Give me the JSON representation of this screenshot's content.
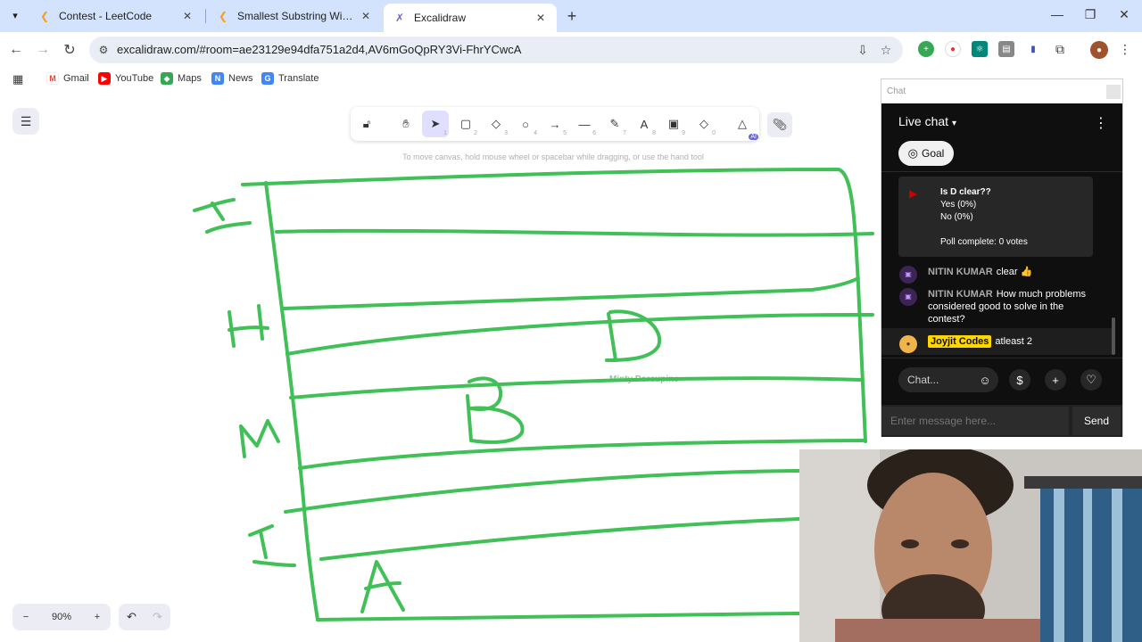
{
  "browser": {
    "tabs": [
      {
        "title": "Contest - LeetCode",
        "favicon": "leetcode-icon"
      },
      {
        "title": "Smallest Substring With Identical",
        "favicon": "leetcode-icon"
      },
      {
        "title": "Excalidraw",
        "favicon": "excalidraw-icon",
        "active": true
      }
    ],
    "url": "excalidraw.com/#room=ae23129e94dfa751a2d4,AV6mGoQpRY3Vi-FhrYCwcA",
    "bookmarks": [
      "Gmail",
      "YouTube",
      "Maps",
      "News",
      "Translate"
    ]
  },
  "excalidraw": {
    "hint": "To move canvas, hold mouse wheel or spacebar while dragging, or use the hand tool",
    "tool_keys": [
      "1",
      "2",
      "3",
      "4",
      "5",
      "6",
      "7",
      "8",
      "9",
      "0"
    ],
    "ai_badge": "AI",
    "zoom": "90%",
    "collaborator": "Minty Porcupine",
    "colors": {
      "stroke": "#40c057",
      "selected_tool": "#e0dfff"
    }
  },
  "chat": {
    "window_label": "Chat",
    "header": "Live chat",
    "goal": "Goal",
    "poll": {
      "question": "Is D clear??",
      "options": [
        "Yes (0%)",
        "No (0%)"
      ],
      "status": "Poll complete: 0 votes"
    },
    "messages": [
      {
        "author": "NITIN KUMAR",
        "text": "clear 👍"
      },
      {
        "author": "NITIN KUMAR",
        "text": "How much problems considered good to solve in the contest?"
      },
      {
        "author": "Joyjit Codes",
        "text": "atleast 2",
        "owner": true
      }
    ],
    "input_placeholder": "Chat...",
    "message_placeholder": "Enter message here...",
    "send": "Send"
  }
}
